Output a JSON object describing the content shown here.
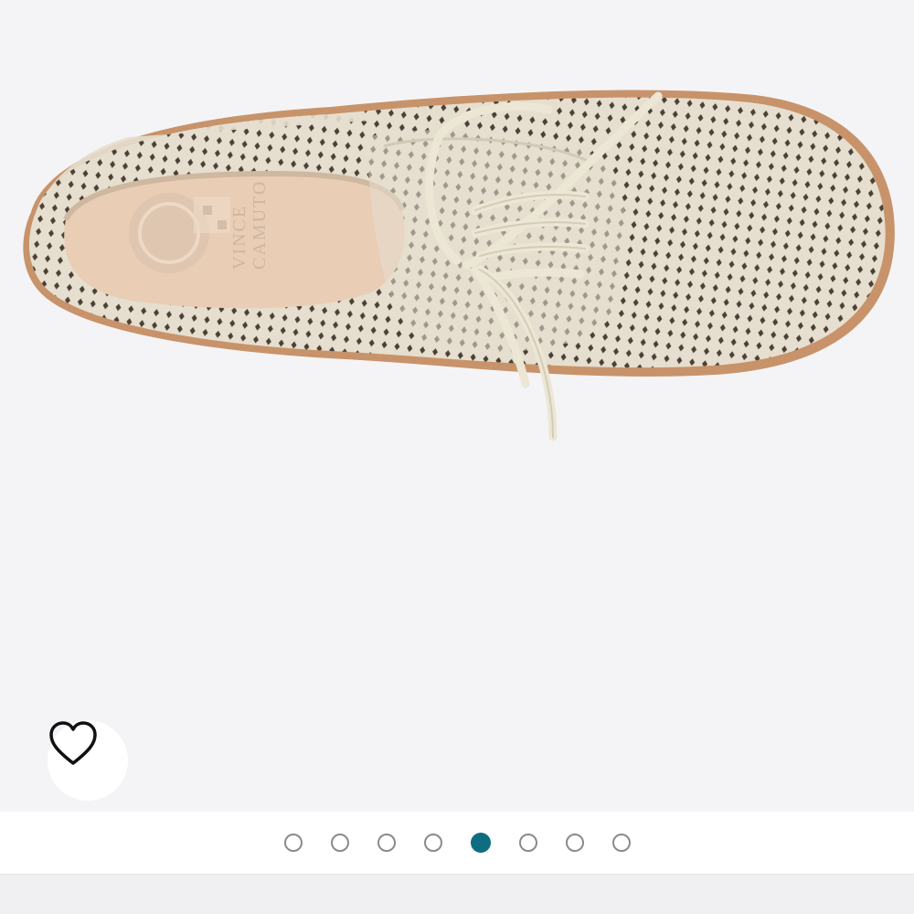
{
  "product_image": {
    "subject": "shoe-image",
    "brand_insole_mark": "VINCE CAMUTO"
  },
  "wishlist": {
    "icon": "heart-outline-icon"
  },
  "carousel": {
    "total": 8,
    "active_index": 4,
    "active_color": "#0f6d82",
    "inactive_border_color": "#8a8a8a"
  },
  "colors": {
    "background": "#f4f4f6",
    "leather": "#e6dfcf",
    "sole": "#c8936a"
  }
}
